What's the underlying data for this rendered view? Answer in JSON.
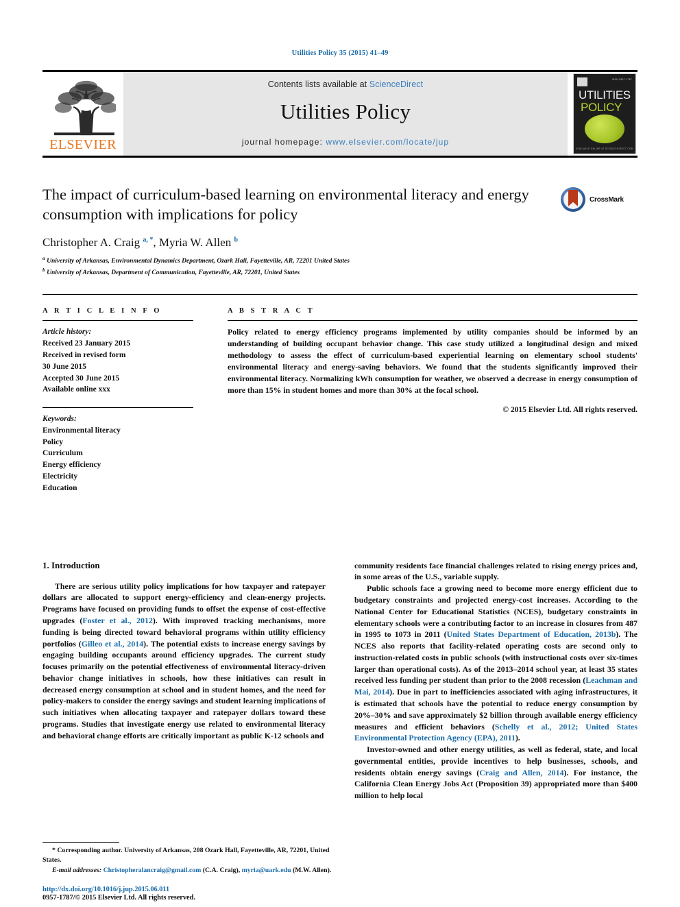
{
  "running_head": "Utilities Policy 35 (2015) 41–49",
  "masthead": {
    "contents_prefix": "Contents lists available at ",
    "sciencedirect": "ScienceDirect",
    "journal_name": "Utilities Policy",
    "homepage_prefix": "journal homepage: ",
    "homepage_url": "www.elsevier.com/locate/jup",
    "publisher_logo_text": "ELSEVIER",
    "cover": {
      "line1": "UTILITIES",
      "line2": "POLICY",
      "corner_tag": "ISSN 0957-1787",
      "footer": "AVAILABLE ONLINE AT SCIENCEDIRECT.COM"
    }
  },
  "article": {
    "title": "The impact of curriculum-based learning on environmental literacy and energy consumption with implications for policy",
    "authors_html": "Christopher A. Craig <sup>a, *</sup>, Myria W. Allen <sup>b</sup>",
    "affiliation_a": "University of Arkansas, Environmental Dynamics Department, Ozark Hall, Fayetteville, AR, 72201 United States",
    "affiliation_b": "University of Arkansas, Department of Communication, Fayetteville, AR, 72201, United States",
    "crossmark_label": "CrossMark"
  },
  "info": {
    "heading": "A R T I C L E   I N F O",
    "history_label": "Article history:",
    "history": [
      "Received 23 January 2015",
      "Received in revised form",
      "30 June 2015",
      "Accepted 30 June 2015",
      "Available online xxx"
    ],
    "keywords_label": "Keywords:",
    "keywords": [
      "Environmental literacy",
      "Policy",
      "Curriculum",
      "Energy efficiency",
      "Electricity",
      "Education"
    ]
  },
  "abstract": {
    "heading": "A B S T R A C T",
    "text": "Policy related to energy efficiency programs implemented by utility companies should be informed by an understanding of building occupant behavior change. This case study utilized a longitudinal design and mixed methodology to assess the effect of curriculum-based experiential learning on elementary school students' environmental literacy and energy-saving behaviors. We found that the students significantly improved their environmental literacy. Normalizing kWh consumption for weather, we observed a decrease in energy consumption of more than 15% in student homes and more than 30% at the focal school.",
    "copyright": "© 2015 Elsevier Ltd. All rights reserved."
  },
  "body": {
    "section_heading": "1. Introduction",
    "left_paragraph_1_parts": {
      "p1": "There are serious utility policy implications for how taxpayer and ratepayer dollars are allocated to support energy-efficiency and clean-energy projects. Programs have focused on providing funds to offset the expense of cost-effective upgrades (",
      "ref1": "Foster et al., 2012",
      "p2": "). With improved tracking mechanisms, more funding is being directed toward behavioral programs within utility efficiency portfolios (",
      "ref2": "Gilleo et al., 2014",
      "p3": "). The potential exists to increase energy savings by engaging building occupants around efficiency upgrades. The current study focuses primarily on the potential effectiveness of environmental literacy-driven behavior change initiatives in schools, how these initiatives can result in decreased energy consumption at school and in student homes, and the need for policy-makers to consider the energy savings and student learning implications of such initiatives when allocating taxpayer and ratepayer dollars toward these programs. Studies that investigate energy use related to environmental literacy and behavioral change efforts are critically important as public K-12 schools and"
    },
    "right_paragraph_1": "community residents face financial challenges related to rising energy prices and, in some areas of the U.S., variable supply.",
    "right_paragraph_2_parts": {
      "p1": "Public schools face a growing need to become more energy efficient due to budgetary constraints and projected energy-cost increases. According to the National Center for Educational Statistics (NCES), budgetary constraints in elementary schools were a contributing factor to an increase in closures from 487 in 1995 to 1073 in 2011 (",
      "ref1": "United States Department of Education, 2013b",
      "p2": "). The NCES also reports that facility-related operating costs are second only to instruction-related costs in public schools (with instructional costs over six-times larger than operational costs). As of the 2013–2014 school year, at least 35 states received less funding per student than prior to the 2008 recession (",
      "ref2": "Leachman and Mai, 2014",
      "p3": "). Due in part to inefficiencies associated with aging infrastructures, it is estimated that schools have the potential to reduce energy consumption by 20%–30% and save approximately $2 billion through available energy efficiency measures and efficient behaviors (",
      "ref3": "Schelly et al., 2012; United States Environmental Protection Agency (EPA), 2011",
      "p4": ")."
    },
    "right_paragraph_3_parts": {
      "p1": "Investor-owned and other energy utilities, as well as federal, state, and local governmental entities, provide incentives to help businesses, schools, and residents obtain energy savings (",
      "ref1": "Craig and Allen, 2014",
      "p2": "). For instance, the California Clean Energy Jobs Act (Proposition 39) appropriated more than $400 million to help local"
    }
  },
  "footnote": {
    "corresponding_marker": "*",
    "corresponding_text": " Corresponding author. University of Arkansas, 208 Ozark Hall, Fayetteville, AR, 72201, United States.",
    "email_label": "E-mail addresses:",
    "email_1": "Christopheralancraig@gmail.com",
    "email_1_owner": " (C.A. Craig), ",
    "email_2": "myria@uark.edu",
    "email_2_owner": " (M.W. Allen)."
  },
  "doi": {
    "url": "http://dx.doi.org/10.1016/j.jup.2015.06.011",
    "issn_line": "0957-1787/© 2015 Elsevier Ltd. All rights reserved."
  },
  "colors": {
    "link_blue": "#1a6ba8",
    "elsevier_orange": "#e87722",
    "masthead_grey": "#e6e6e6"
  }
}
